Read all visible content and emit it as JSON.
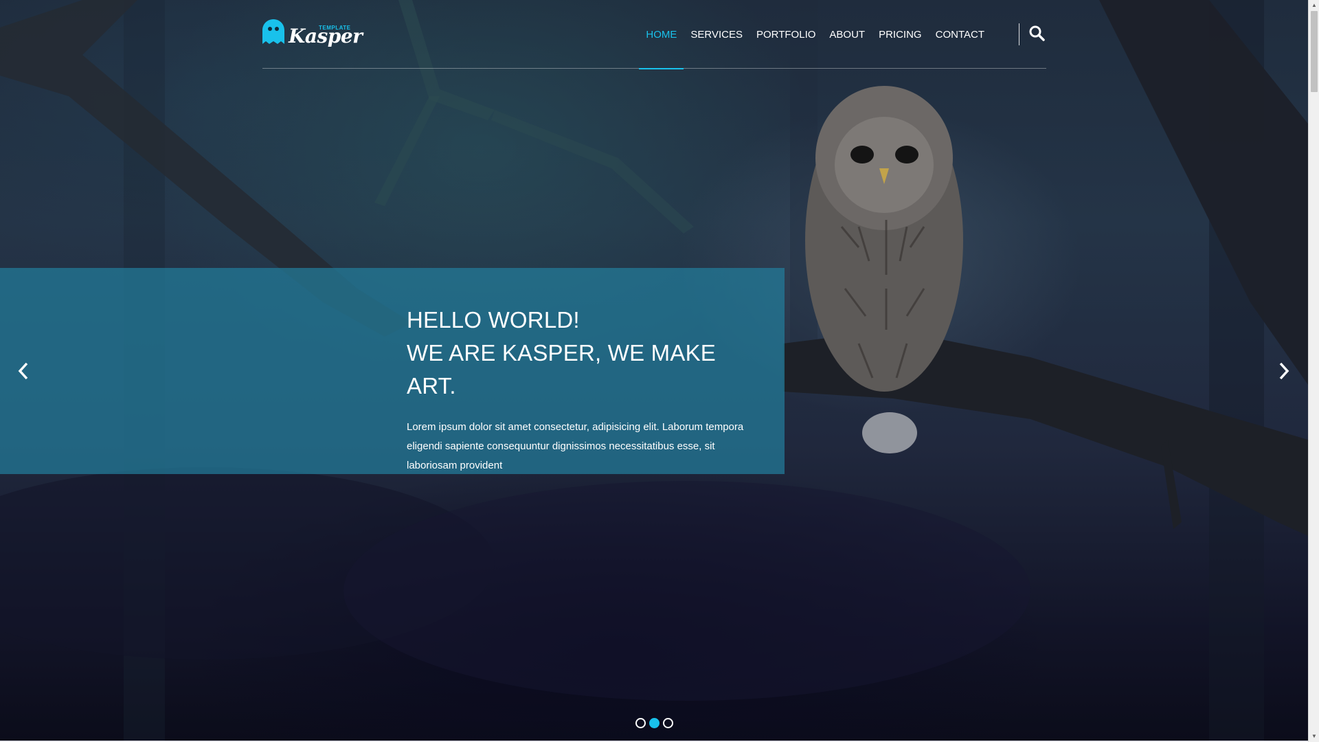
{
  "brand": {
    "logo_text": "Kasper",
    "logo_sub": "TEMPLATE",
    "accent_color": "#19c1eb"
  },
  "nav": {
    "items": [
      {
        "label": "HOME",
        "active": true
      },
      {
        "label": "SERVICES",
        "active": false
      },
      {
        "label": "PORTFOLIO",
        "active": false
      },
      {
        "label": "ABOUT",
        "active": false
      },
      {
        "label": "PRICING",
        "active": false
      },
      {
        "label": "CONTACT",
        "active": false
      }
    ],
    "search_icon": "search-icon"
  },
  "hero": {
    "title_line1": "HELLO WORLD!",
    "title_line2": "WE ARE KASPER, WE MAKE ART.",
    "text": "Lorem ipsum dolor sit amet consectetur, adipisicing elit. Laborum tempora eligendi sapiente consequuntur dignissimos necessitatibus esse, sit laboriosam provident",
    "prev_icon": "chevron-left-icon",
    "next_icon": "chevron-right-icon"
  },
  "slider": {
    "slides": 3,
    "active_index": 1
  }
}
